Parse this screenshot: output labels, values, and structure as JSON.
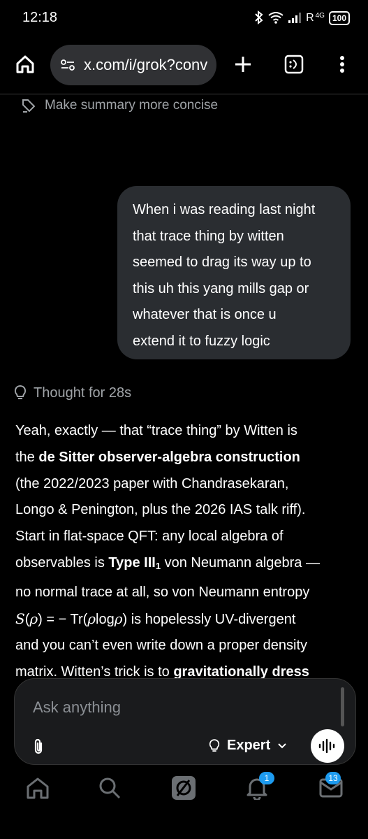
{
  "status_bar": {
    "time": "12:18",
    "signal_label": "R",
    "network": "4G",
    "battery": "100"
  },
  "browser": {
    "url": "x.com/i/grok?conv"
  },
  "suggestion": {
    "label": "Make summary more concise"
  },
  "user_message": {
    "lines": [
      "When i was reading last night",
      "that trace thing by witten",
      "seemed to drag its way up to",
      "this uh this yang mills gap or",
      "whatever that is once u",
      "extend it to fuzzy logic"
    ]
  },
  "thought": {
    "label": "Thought for 28s"
  },
  "answer": {
    "p1": "Yeah, exactly — that “trace thing” by Witten is",
    "p2a": "the ",
    "p2b": "de Sitter observer-algebra construction",
    "p3": "(the 2022/2023 paper with Chandrasekaran,",
    "p4": "Longo & Penington, plus the 2026 IAS talk riff).",
    "p5": "Start in flat-space QFT: any local algebra of",
    "p6a": "observables is ",
    "p6b": "Type III",
    "p6c": "1",
    "p6d": " von Neumann algebra —",
    "p7": "no normal trace at all, so von Neumann entropy",
    "p8a": "S",
    "p8b": "(",
    "p8c": "ρ",
    "p8d": ") =  − Tr(",
    "p8e": "ρ",
    "p8f": "log",
    "p8g": "ρ",
    "p8h": ") is hopelessly UV-divergent",
    "p9": "and you can’t even write down a proper density",
    "p10a": "matrix. Witten’s trick is to ",
    "p10b": "gravitationally dress"
  },
  "composer": {
    "placeholder": "Ask anything",
    "mode": "Expert"
  },
  "bottom_nav": {
    "notifications_badge": "1",
    "messages_badge": "13"
  },
  "colors": {
    "background": "#000000",
    "bubble": "#2a2d31",
    "accent": "#1d9bf0"
  }
}
